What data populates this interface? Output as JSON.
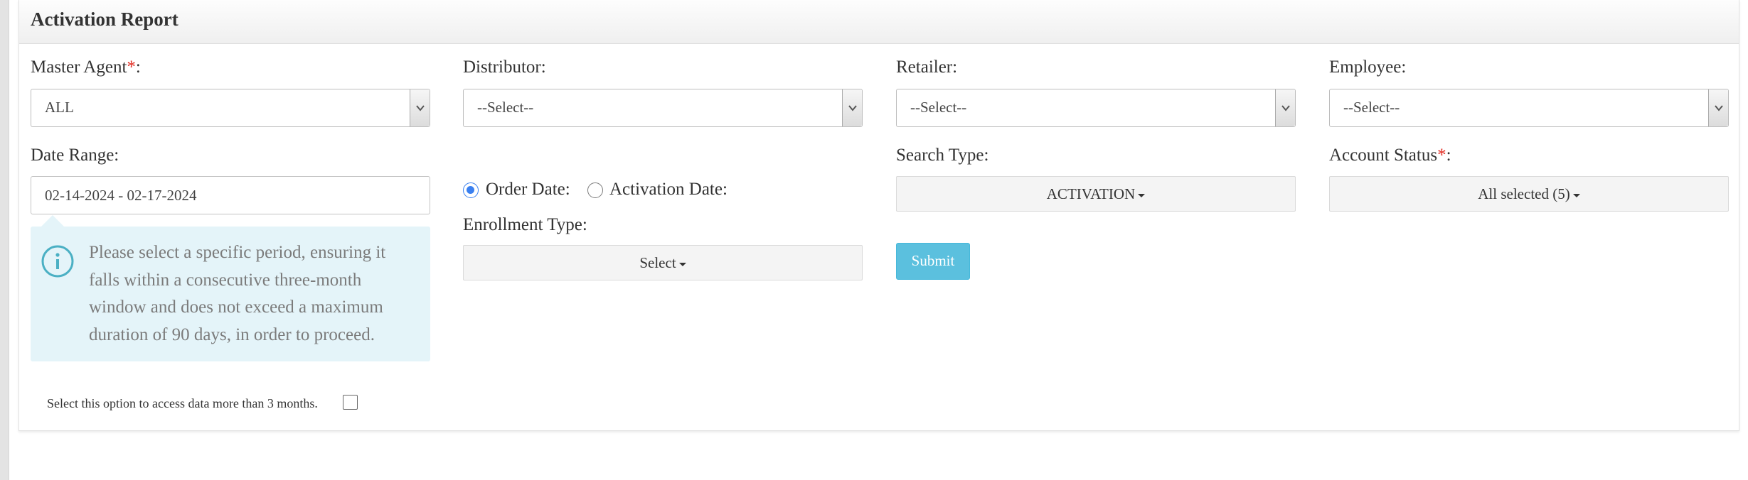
{
  "panel": {
    "title": "Activation Report"
  },
  "filters": {
    "master_agent": {
      "label": "Master Agent",
      "required_mark": "*",
      "colon": ":",
      "value": "ALL"
    },
    "distributor": {
      "label": "Distributor:",
      "value": "--Select--"
    },
    "retailer": {
      "label": "Retailer:",
      "value": "--Select--"
    },
    "employee": {
      "label": "Employee:",
      "value": "--Select--"
    },
    "date_range": {
      "label": "Date Range:",
      "value": "02-14-2024 - 02-17-2024"
    },
    "date_type": {
      "options": [
        {
          "label": "Order Date:",
          "selected": true
        },
        {
          "label": "Activation Date:",
          "selected": false
        }
      ]
    },
    "enrollment_type": {
      "label": "Enrollment Type:",
      "value": "Select"
    },
    "search_type": {
      "label": "Search Type:",
      "value": "ACTIVATION"
    },
    "account_status": {
      "label": "Account Status",
      "required_mark": "*",
      "colon": ":",
      "value": "All selected (5)"
    }
  },
  "info_message": "Please select a specific period, ensuring it falls within a consecutive three-month window and does not exceed a maximum duration of 90 days, in order to proceed.",
  "submit_label": "Submit",
  "extended_range_option": {
    "label": "Select this option to access data more than 3 months.",
    "checked": false
  },
  "colors": {
    "info_bg": "#e4f4f9",
    "submit_bg": "#5bc0de",
    "radio_accent": "#3a80f0",
    "required": "#e0251b"
  }
}
